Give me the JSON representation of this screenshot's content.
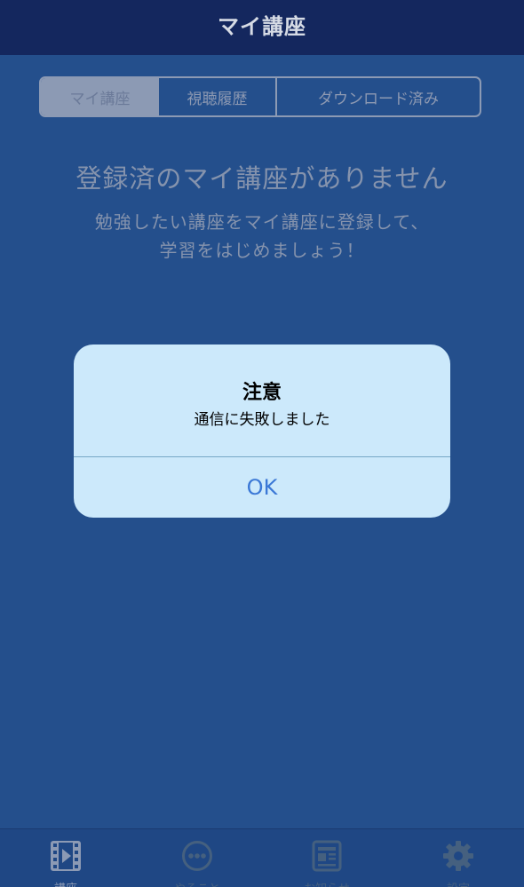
{
  "header": {
    "title": "マイ講座"
  },
  "segments": [
    {
      "label": "マイ講座",
      "selected": true
    },
    {
      "label": "視聴履歴",
      "selected": false
    },
    {
      "label": "ダウンロード済み",
      "selected": false
    }
  ],
  "empty_state": {
    "title": "登録済のマイ講座がありません",
    "message_line1": "勉強したい講座をマイ講座に登録して、",
    "message_line2": "学習をはじめましょう！"
  },
  "alert": {
    "title": "注意",
    "message": "通信に失敗しました",
    "ok_label": "OK"
  },
  "tabbar": {
    "tabs": [
      {
        "label": "講座",
        "icon": "film-play-icon",
        "selected": true
      },
      {
        "label": "やること",
        "icon": "more-dots-icon",
        "selected": false
      },
      {
        "label": "お知らせ",
        "icon": "newspaper-icon",
        "selected": false
      },
      {
        "label": "設定",
        "icon": "gear-icon",
        "selected": false
      }
    ]
  },
  "colors": {
    "background": "#244f8c",
    "navbar": "#14275e",
    "alert_background": "#cce9fb",
    "alert_button": "#3b78d6"
  }
}
